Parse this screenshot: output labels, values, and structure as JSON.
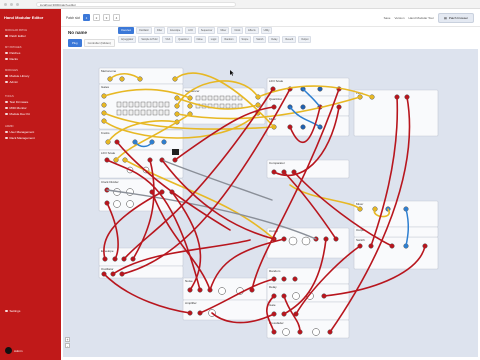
{
  "browser": {
    "url": "localhost:3000/patch-editor"
  },
  "sidebar": {
    "app_title": "Hand Modular Editor",
    "sections": [
      {
        "label": "MODULAR PATCH",
        "items": [
          "Patch Editor"
        ]
      },
      {
        "label": "MY PATCHES",
        "items": [
          "Patches",
          "Racks"
        ]
      },
      {
        "label": "MODULES",
        "items": [
          "Module Library",
          "Admin"
        ]
      },
      {
        "label": "TOOLS",
        "items": [
          "Test Firmware",
          "MIDI Monitor",
          "Module Dev Kit"
        ]
      },
      {
        "label": "ADMIN",
        "items": [
          "User Management",
          "Rack Management"
        ]
      }
    ],
    "settings_label": "Settings",
    "user_name": "Admin"
  },
  "topbar": {
    "selector_label": "Patch slot",
    "pages": [
      "1",
      "2",
      "3",
      "4"
    ],
    "active_page": "1",
    "right_links": [
      "Save",
      "Version",
      "Hand Modular Tour"
    ],
    "patch_browser_button": "Patch browser"
  },
  "patch": {
    "name": "No name",
    "tabs": [
      "Plug",
      "Controller (hidden)"
    ],
    "active_tab": "Plug"
  },
  "module_tabs_row1": [
    "Overview",
    "Oscillator",
    "Filter",
    "Envelope",
    "LFO",
    "Sequencer",
    "Mixer",
    "Clock",
    "Effects",
    "Utility"
  ],
  "module_tabs_row2": [
    "Arpeggiator",
    "Sample & Hold",
    "VCA",
    "Quantizer",
    "Noise",
    "Logic",
    "Random",
    "Scope",
    "Switch",
    "Delay",
    "Reverb",
    "Output"
  ],
  "active_module_tab": "Overview",
  "canvas": {
    "modules": [
      {
        "title": "Metronome"
      },
      {
        "title": "Gates"
      },
      {
        "title": "Sequencer"
      },
      {
        "title": "Knobs"
      },
      {
        "title": "LFO Scale"
      },
      {
        "title": "Clock Divider"
      },
      {
        "title": "Envelope"
      },
      {
        "title": "Oscillator"
      },
      {
        "title": "LFO Scale"
      },
      {
        "title": "Quantizer"
      },
      {
        "title": "Mixer"
      },
      {
        "title": "Filter"
      },
      {
        "title": "Comparator"
      },
      {
        "title": "Mixer"
      },
      {
        "title": "Switch"
      },
      {
        "title": "Output"
      },
      {
        "title": "Noise"
      },
      {
        "title": "Random"
      },
      {
        "title": "Delay"
      },
      {
        "title": "Gate"
      },
      {
        "title": "Crossfader"
      },
      {
        "title": "Amplifier"
      },
      {
        "title": "Output"
      }
    ],
    "zoom_controls": [
      "+",
      "-"
    ]
  },
  "colors": {
    "sidebar": "#c01919",
    "accent": "#3b78d8",
    "cable_red": "#b8161e",
    "cable_yellow": "#e7b824",
    "cable_blue": "#2e7fd0",
    "cable_gray": "#8a8f98",
    "canvas_bg": "#dde3ee"
  }
}
